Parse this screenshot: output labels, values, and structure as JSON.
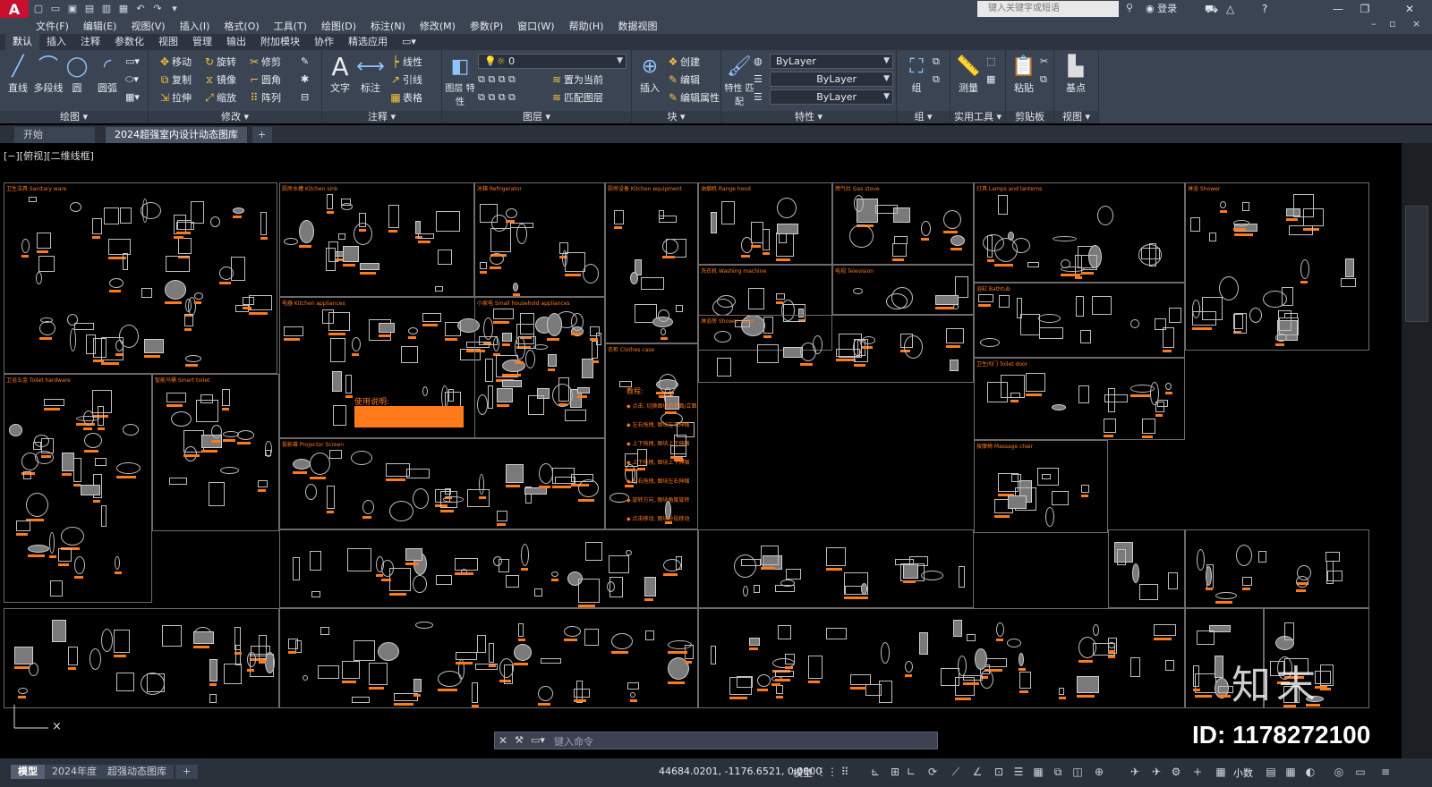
{
  "titlebar": {
    "logo": "A",
    "search_placeholder": "键入关键字或短语",
    "login": "登录"
  },
  "menubar": [
    "文件(F)",
    "编辑(E)",
    "视图(V)",
    "插入(I)",
    "格式(O)",
    "工具(T)",
    "绘图(D)",
    "标注(N)",
    "修改(M)",
    "参数(P)",
    "窗口(W)",
    "帮助(H)",
    "数据视图"
  ],
  "ribbon_tabs": [
    "默认",
    "插入",
    "注释",
    "参数化",
    "视图",
    "管理",
    "输出",
    "附加模块",
    "协作",
    "精选应用"
  ],
  "ribbon": {
    "draw": {
      "title": "绘图",
      "line": "直线",
      "polyline": "多段线",
      "circle": "圆",
      "arc": "圆弧"
    },
    "modify": {
      "title": "修改",
      "move": "移动",
      "rotate": "旋转",
      "trim": "修剪",
      "copy": "复制",
      "mirror": "镜像",
      "fillet": "圆角",
      "stretch": "拉伸",
      "scale": "缩放",
      "array": "阵列"
    },
    "annotation": {
      "title": "注释",
      "text": "文字",
      "dimension": "标注",
      "linear": "线性",
      "leader": "引线",
      "table": "表格"
    },
    "layers": {
      "title": "图层",
      "layer_props": "图层\n特性",
      "current_layer": "0",
      "set_current": "置为当前",
      "match_layer": "匹配图层"
    },
    "block": {
      "title": "块",
      "insert": "插入",
      "create": "创建",
      "edit": "编辑",
      "edit_attr": "编辑属性"
    },
    "properties": {
      "title": "特性",
      "match": "特性\n匹配",
      "color": "ByLayer",
      "linetype": "ByLayer",
      "lineweight": "ByLayer"
    },
    "groups": {
      "title": "组",
      "group": "组"
    },
    "utilities": {
      "title": "实用工具",
      "measure": "测量"
    },
    "clipboard": {
      "title": "剪贴板",
      "paste": "粘贴"
    },
    "view": {
      "title": "视图",
      "base": "基点"
    }
  },
  "doc_tabs": {
    "start": "开始",
    "active": "2024超强室内设计动态图库*"
  },
  "view_label": "[−][俯视][二维线框]",
  "canvas_cells": [
    "卫生洁具 Sanitary ware",
    "厨房水槽 Kitchen sink",
    "冰箱 Refrigerator",
    "厨房设备 Kitchen equipment",
    "油烟机 Range hood",
    "燃气灶 Gas stove",
    "灯具 Lamps and lanterns",
    "淋浴 Shower",
    "卫浴五金 Toilet hardware",
    "智能马桶 Smart toilet",
    "电器 Kitchen appliances",
    "小家电 Small household appliances",
    "洗衣机 Washing machine",
    "电视 Television",
    "浴缸 Bathtub",
    "淋浴房 Shower room",
    "卫生间门 Toilet door",
    "投影幕 Projector Screen",
    "衣柜 Clothes case",
    "按摩椅 Massage chair"
  ],
  "instructions": {
    "title": "使用说明:",
    "heading": "教程:",
    "steps": [
      "点击, 切换图块的平面/立面",
      "左右拖拽, 图块左右伸缩",
      "上下拖拽, 图块上下伸缩",
      "上下拖拽, 图块上下伸缩",
      "左右拖拽, 图块左右伸缩",
      "旋转方向, 图块角度旋转",
      "点击移动, 图块分段移动"
    ]
  },
  "watermark": "知末",
  "id_mark": "ID: 1178272100",
  "command_placeholder": "键入命令",
  "statusbar": {
    "layout_tabs": [
      "模型",
      "2024年度",
      "超强动态图库"
    ],
    "coords": "44684.0201, -1176.6521, 0.0000",
    "model": "模型",
    "units": "小数"
  },
  "colors": {
    "accent": "#ff7a1a",
    "titlebar": "#3b4453",
    "ribbon": "#3b4453",
    "canvas": "#000000"
  }
}
